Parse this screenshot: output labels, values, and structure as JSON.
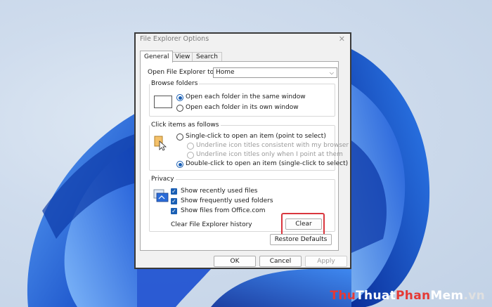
{
  "window": {
    "title": "File Explorer Options",
    "close_glyph": "✕"
  },
  "tabs": [
    {
      "label": "General",
      "active": true
    },
    {
      "label": "View",
      "active": false
    },
    {
      "label": "Search",
      "active": false
    }
  ],
  "open_explorer": {
    "label": "Open File Explorer to:",
    "value": "Home",
    "icon": "chevron-down-icon"
  },
  "browse_folders": {
    "legend": "Browse folders",
    "options": [
      {
        "label": "Open each folder in the same window",
        "selected": true
      },
      {
        "label": "Open each folder in its own window",
        "selected": false
      }
    ]
  },
  "click_items": {
    "legend": "Click items as follows",
    "single_click": "Single-click to open an item (point to select)",
    "underline_consistent": "Underline icon titles consistent with my browser",
    "underline_point": "Underline icon titles only when I point at them",
    "double_click": "Double-click to open an item (single-click to select)"
  },
  "privacy": {
    "legend": "Privacy",
    "recent": "Show recently used files",
    "frequent": "Show frequently used folders",
    "office": "Show files from Office.com",
    "history_label": "Clear File Explorer history",
    "clear_button": "Clear",
    "highlight_color": "#d9363e"
  },
  "restore_button": "Restore Defaults",
  "footer": {
    "ok": "OK",
    "cancel": "Cancel",
    "apply": "Apply"
  },
  "watermark": {
    "part1": "Thu",
    "part2": "Thuat",
    "part3": "Phan",
    "part4": "Mem",
    "part5": ".vn"
  },
  "colors": {
    "accent": "#1a5fb4",
    "wallpaper_blue": "#1f5fd6"
  }
}
